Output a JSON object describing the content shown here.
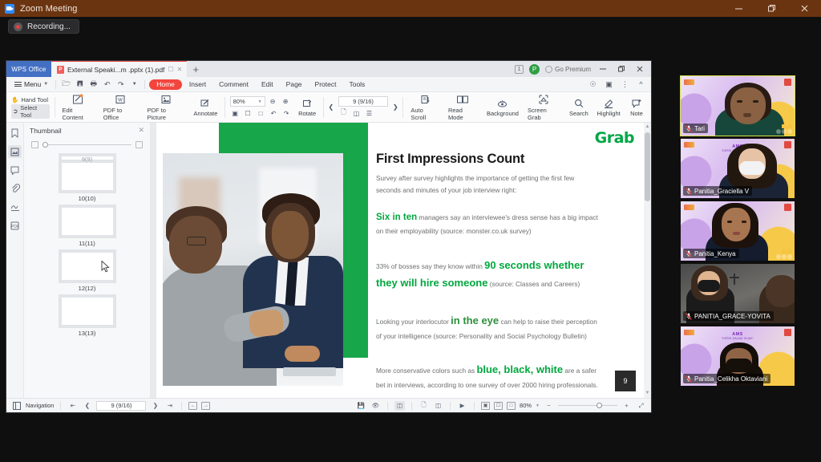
{
  "zoom_window": {
    "title": "Zoom Meeting",
    "app_icon": "zoom-camera-icon",
    "recording_label": "Recording...",
    "window_controls": {
      "minimize": "minimize-icon",
      "maximize": "restore-icon",
      "close": "close-icon"
    }
  },
  "wps": {
    "brand_tab": "WPS Office",
    "document_tab": {
      "title": "External Speaki...m .pptx (1).pdf",
      "icon": "pdf-file-icon"
    },
    "new_tab": "+",
    "tabbar_right": {
      "window_count": "1",
      "avatar_initial": "P",
      "premium_label": "Go Premium"
    },
    "menu": {
      "label": "Menu"
    },
    "ribbon_tabs": [
      {
        "label": "Home",
        "active": true
      },
      {
        "label": "Insert",
        "active": false
      },
      {
        "label": "Comment",
        "active": false
      },
      {
        "label": "Edit",
        "active": false
      },
      {
        "label": "Page",
        "active": false
      },
      {
        "label": "Protect",
        "active": false
      },
      {
        "label": "Tools",
        "active": false
      }
    ],
    "toolbar": {
      "hand_tool": "Hand Tool",
      "select_tool": "Select Tool",
      "edit_content": "Edit Content",
      "pdf_to_office": "PDF to Office",
      "pdf_to_picture": "PDF to Picture",
      "annotate": "Annotate",
      "zoom_value": "80%",
      "rotate": "Rotate",
      "page_field": "9 (9/16)",
      "auto_scroll": "Auto Scroll",
      "read_mode": "Read Mode",
      "background": "Background",
      "screen_grab": "Screen Grab",
      "search": "Search",
      "highlight": "Highlight",
      "note": "Note"
    },
    "thumbnail_panel": {
      "title": "Thumbnail",
      "partial_top_label": "9(9)",
      "items": [
        {
          "label": "10(10)"
        },
        {
          "label": "11(11)"
        },
        {
          "label": "12(12)"
        },
        {
          "label": "13(13)"
        }
      ]
    },
    "status_bar": {
      "navigation": "Navigation",
      "page_field": "9 (9/16)",
      "zoom_value": "80%"
    }
  },
  "slide": {
    "brand_logo": "Grab",
    "heading": "First Impressions Count",
    "intro_line1": "Survey after survey highlights the importance of getting the first few",
    "intro_line2": "seconds and minutes of your job interview right:",
    "stat1_strong": "Six in ten",
    "stat1_rest": " managers say an interviewee's dress sense has a big impact",
    "stat1_line2": "on their employability (source: monster.co.uk survey)",
    "stat2_lead": "33% of bosses say they know within ",
    "stat2_strong": "90 seconds whether",
    "stat2_strong2": "they will hire someone",
    "stat2_rest": " (source: Classes and Careers)",
    "stat3_lead": "Looking your interlocutor ",
    "stat3_strong": "in the eye",
    "stat3_rest": " can help to raise their perception",
    "stat3_line2": "of your intelligence (source: Personality and Social Psychology Bulletin)",
    "stat4_lead": "More conservative colors such as ",
    "stat4_strong": "blue, black, white",
    "stat4_rest": " are a safer",
    "stat4_line2": "bet in interviews, according to one survey of over 2000 hiring professionals.",
    "page_badge": "9",
    "accent_color": "#18a64a",
    "brand_color": "#00a745"
  },
  "participants": [
    {
      "name": "Tari",
      "active": true,
      "muted": true,
      "style": "purple"
    },
    {
      "name": "Panitia_Graciella V",
      "active": false,
      "muted": true,
      "style": "purple"
    },
    {
      "name": "Panitia_Kenya",
      "active": false,
      "muted": true,
      "style": "purple"
    },
    {
      "name": "PANITIA_GRACE-YOVITA",
      "active": false,
      "muted": true,
      "style": "dark"
    },
    {
      "name": "Panitia_Celikha Oktaviani",
      "active": false,
      "muted": true,
      "style": "purple"
    }
  ],
  "virtual_background": {
    "title": "AMS",
    "subtitle": "\"KERIS DALAM TAJAK\""
  }
}
